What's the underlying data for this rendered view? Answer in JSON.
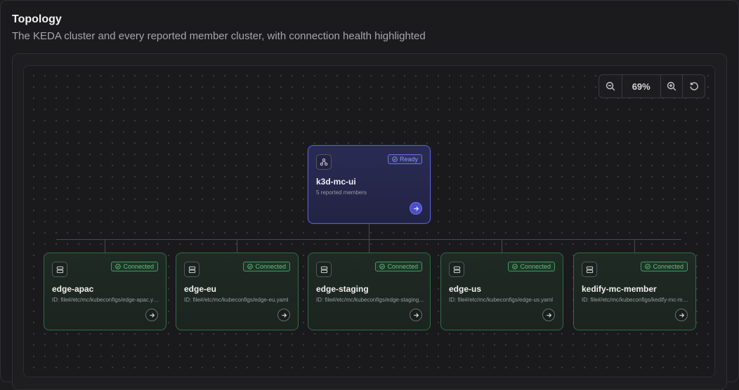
{
  "header": {
    "title": "Topology",
    "subtitle": "The KEDA cluster and every reported member cluster, with connection health highlighted"
  },
  "zoom": {
    "value": "69%",
    "zoom_out_icon": "zoom-out-icon",
    "zoom_in_icon": "zoom-in-icon",
    "reset_icon": "reset-icon"
  },
  "root": {
    "name": "k3d-mc-ui",
    "subtitle": "5 reported members",
    "status": "Ready",
    "icon": "cluster-hub-icon"
  },
  "members": [
    {
      "name": "edge-apac",
      "id_text": "ID: file#/etc/mc/kubeconfigs/edge-apac.yaml",
      "status": "Connected"
    },
    {
      "name": "edge-eu",
      "id_text": "ID: file#/etc/mc/kubeconfigs/edge-eu.yaml",
      "status": "Connected"
    },
    {
      "name": "edge-staging",
      "id_text": "ID: file#/etc/mc/kubeconfigs/edge-staging.yaml",
      "status": "Connected"
    },
    {
      "name": "edge-us",
      "id_text": "ID: file#/etc/mc/kubeconfigs/edge-us.yaml",
      "status": "Connected"
    },
    {
      "name": "kedify-mc-member",
      "id_text": "ID: file#/etc/mc/kubeconfigs/kedify-mc-member.yaml",
      "status": "Connected"
    }
  ],
  "colors": {
    "ready_accent": "#5b5fd6",
    "connected_accent": "#3e9b5d"
  }
}
